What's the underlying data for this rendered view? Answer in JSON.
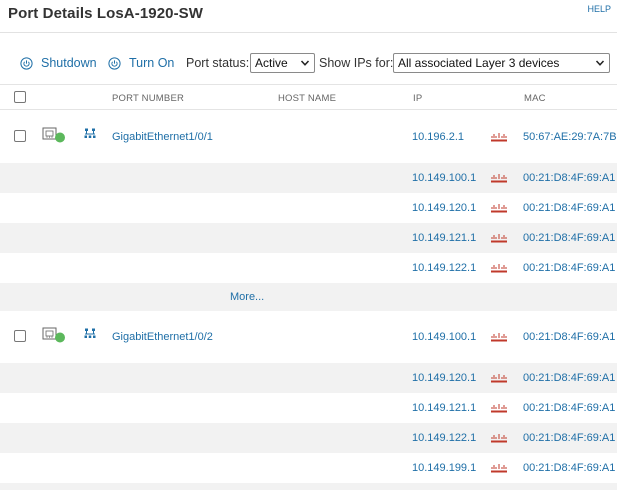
{
  "header": {
    "title": "Port Details LosA-1920-SW",
    "help": "HELP"
  },
  "toolbar": {
    "shutdown": "Shutdown",
    "turn_on": "Turn On",
    "port_status_label": "Port status:",
    "port_status_value": "Active",
    "show_ips_label": "Show IPs for:",
    "show_ips_value": "All associated Layer 3 devices"
  },
  "table": {
    "columns": {
      "port_number": "PORT NUMBER",
      "host_name": "HOST NAME",
      "ip": "IP",
      "mac": "MAC"
    },
    "ports": [
      {
        "name": "GigabitEthernet1/0/1",
        "status_color": "#5cb85c",
        "entries": [
          {
            "ip": "10.196.2.1",
            "mac": "50:67:AE:29:7A:7B"
          },
          {
            "ip": "10.149.100.1",
            "mac": "00:21:D8:4F:69:A1"
          },
          {
            "ip": "10.149.120.1",
            "mac": "00:21:D8:4F:69:A1"
          },
          {
            "ip": "10.149.121.1",
            "mac": "00:21:D8:4F:69:A1"
          },
          {
            "ip": "10.149.122.1",
            "mac": "00:21:D8:4F:69:A1"
          }
        ],
        "more": "More..."
      },
      {
        "name": "GigabitEthernet1/0/2",
        "status_color": "#5cb85c",
        "entries": [
          {
            "ip": "10.149.100.1",
            "mac": "00:21:D8:4F:69:A1"
          },
          {
            "ip": "10.149.120.1",
            "mac": "00:21:D8:4F:69:A1"
          },
          {
            "ip": "10.149.121.1",
            "mac": "00:21:D8:4F:69:A1"
          },
          {
            "ip": "10.149.122.1",
            "mac": "00:21:D8:4F:69:A1"
          },
          {
            "ip": "10.149.199.1",
            "mac": "00:21:D8:4F:69:A1"
          }
        ]
      }
    ]
  },
  "icons": {
    "power": "power-icon",
    "port": "ethernet-port-icon",
    "network": "network-topology-icon",
    "vendor": "cisco-logo-icon",
    "chevron": "chevron-down-icon"
  },
  "colors": {
    "link": "#1f6fa7",
    "status_up": "#5cb85c",
    "alt_row": "#f2f2f2"
  }
}
